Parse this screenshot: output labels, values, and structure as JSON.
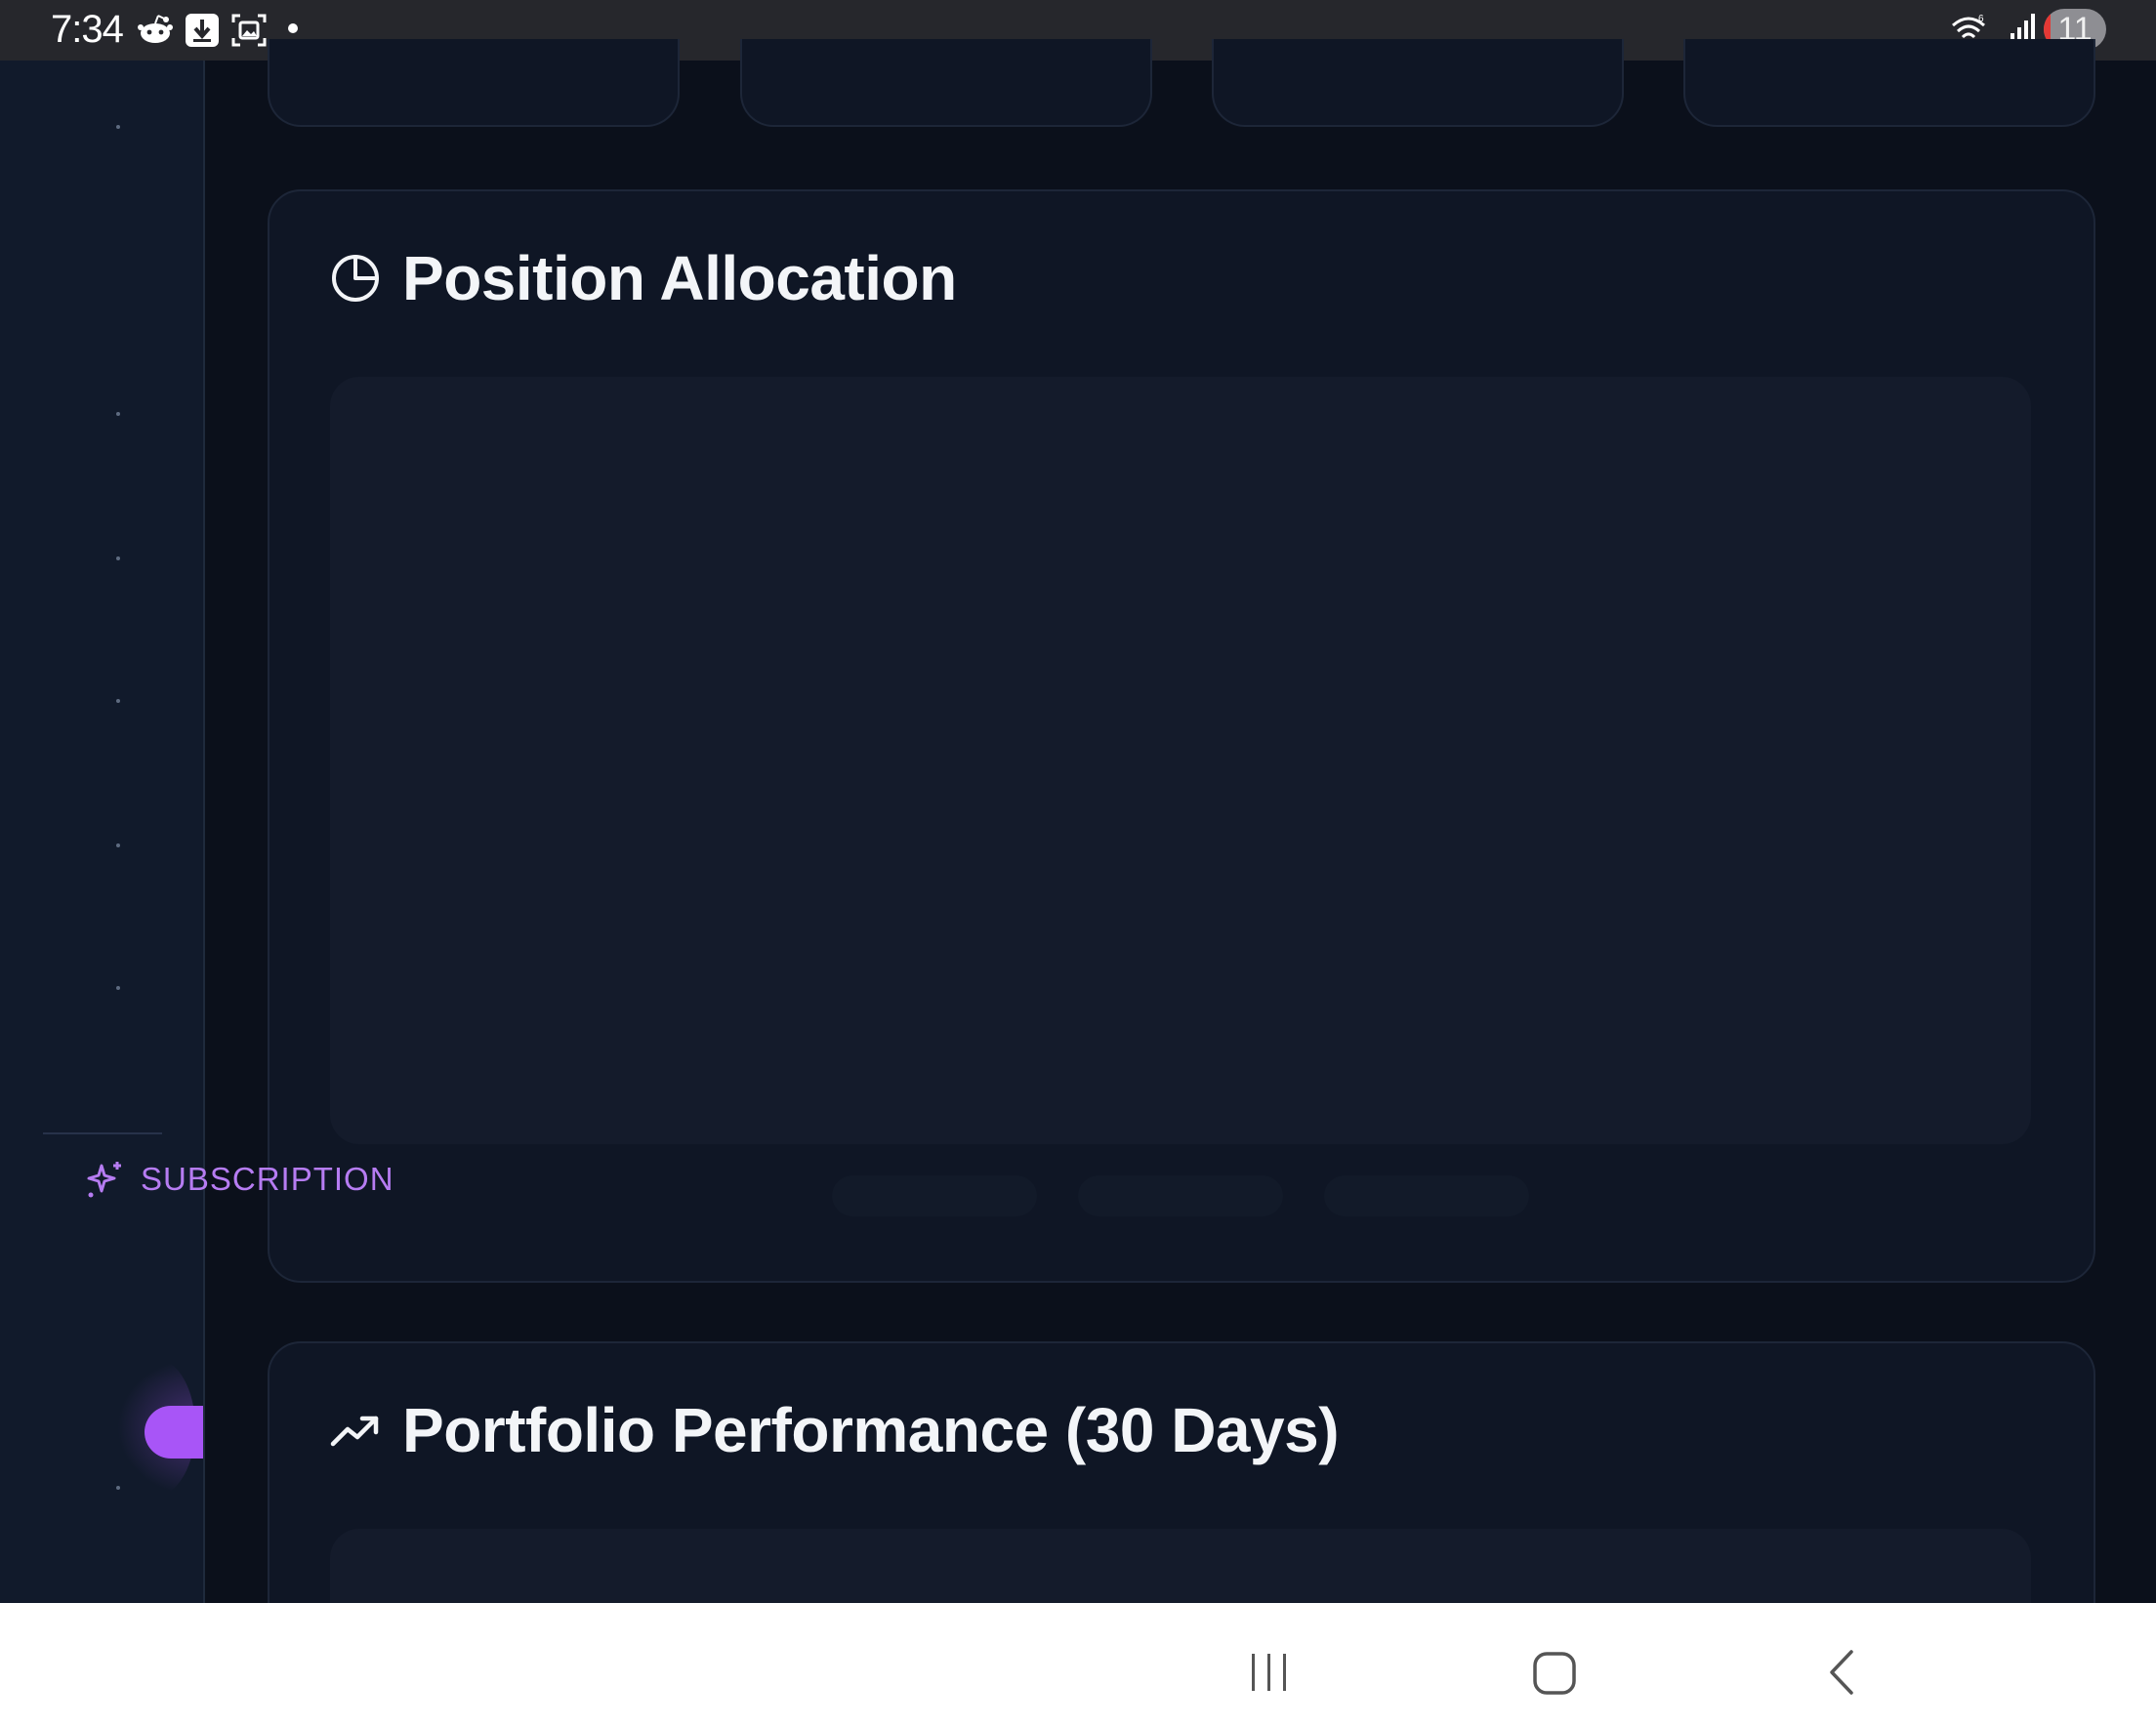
{
  "status_bar": {
    "time": "7:34",
    "notification_icons": [
      "reddit-icon",
      "download-icon",
      "screenshot-icon",
      "dot-icon"
    ],
    "system_icons": [
      "wifi-icon",
      "signal-icon"
    ],
    "battery": {
      "label": "11",
      "level_percent": 11
    }
  },
  "sidebar": {
    "subscription_label": "SUBSCRIPTION",
    "subscription_icon": "sparkle-icon",
    "accent_color": "#a855f7"
  },
  "main": {
    "allocation_panel": {
      "title": "Position Allocation",
      "icon": "pie-chart-icon"
    },
    "performance_panel": {
      "title": "Portfolio Performance (30 Days)",
      "icon": "trending-up-icon"
    }
  },
  "nav_bar": {
    "buttons": [
      "recents-button",
      "home-button",
      "back-button"
    ]
  }
}
